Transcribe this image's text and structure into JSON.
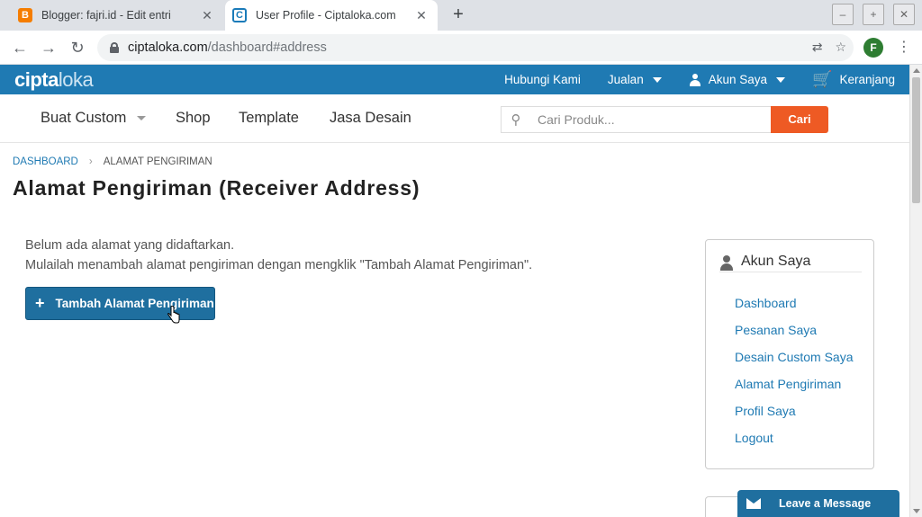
{
  "browser": {
    "tabs": [
      {
        "title": "Blogger: fajri.id - Edit entri",
        "close": "✕"
      },
      {
        "title": "User Profile - Ciptaloka.com",
        "close": "✕"
      }
    ],
    "new_tab": "+",
    "window_buttons": [
      "–",
      "+",
      "✕"
    ],
    "url_host": "ciptaloka.com",
    "url_path": "/dashboard#address",
    "profile_initial": "F"
  },
  "site": {
    "logo_main": "cipta",
    "logo_sub": "loka",
    "topnav": {
      "contact": "Hubungi Kami",
      "sell": "Jualan",
      "account": "Akun Saya",
      "cart": "Keranjang"
    },
    "mainnav": {
      "custom": "Buat Custom",
      "shop": "Shop",
      "template": "Template",
      "design": "Jasa Desain"
    },
    "search": {
      "placeholder": "Cari Produk...",
      "button": "Cari"
    }
  },
  "breadcrumb": {
    "root": "DASHBOARD",
    "current": "ALAMAT PENGIRIMAN"
  },
  "page_title": "Alamat Pengiriman (Receiver Address)",
  "content": {
    "line1": "Belum ada alamat yang didaftarkan.",
    "line2": "Mulailah menambah alamat pengiriman dengan mengklik \"Tambah Alamat Pengiriman\".",
    "add_button": "Tambah Alamat Pengiriman"
  },
  "sidebar": {
    "title": "Akun Saya",
    "items": [
      "Dashboard",
      "Pesanan Saya",
      "Desain Custom Saya",
      "Alamat Pengiriman",
      "Profil Saya",
      "Logout"
    ]
  },
  "chat": {
    "label": "Leave a Message"
  },
  "colors": {
    "brand": "#1f7ab3",
    "search_button": "#ee5a24",
    "add_button": "#1f6f9f"
  }
}
